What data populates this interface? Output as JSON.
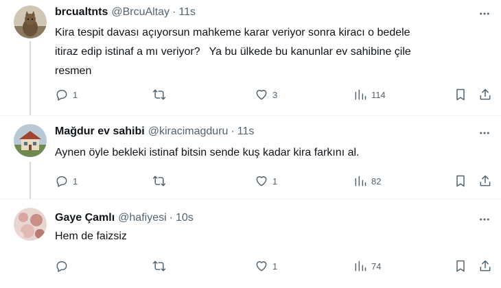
{
  "tweets": [
    {
      "name": "brcualtnts",
      "handle": "@BrcuAltay",
      "time": "11s",
      "text": "Kira tespit davası açıyorsun mahkeme karar veriyor sonra kiracı o bedele\nitiraz edip istinaf a mı veriyor?   Ya bu ülkede bu kanunlar ev sahibine çile\nresmen",
      "replies": "1",
      "retweets": "",
      "likes": "3",
      "views": "114"
    },
    {
      "name": "Mağdur ev sahibi",
      "handle": "@kiracimagduru",
      "time": "11s",
      "text": "Aynen öyle bekleki istinaf bitsin sende kuş kadar kira farkını al.",
      "replies": "1",
      "retweets": "",
      "likes": "1",
      "views": "82"
    },
    {
      "name": "Gaye Çamlı",
      "handle": "@hafiyesi",
      "time": "10s",
      "text": "Hem de faizsiz",
      "replies": "",
      "retweets": "",
      "likes": "1",
      "views": "74"
    }
  ],
  "separator": "·",
  "icons": {
    "reply": "reply-icon",
    "retweet": "retweet-icon",
    "like": "heart-icon",
    "views": "views-icon",
    "bookmark": "bookmark-icon",
    "share": "share-icon",
    "more": "more-icon"
  },
  "colors": {
    "text": "#0f1419",
    "secondary": "#536471",
    "thread_line": "#cfd9de",
    "divider": "#eff3f4"
  }
}
